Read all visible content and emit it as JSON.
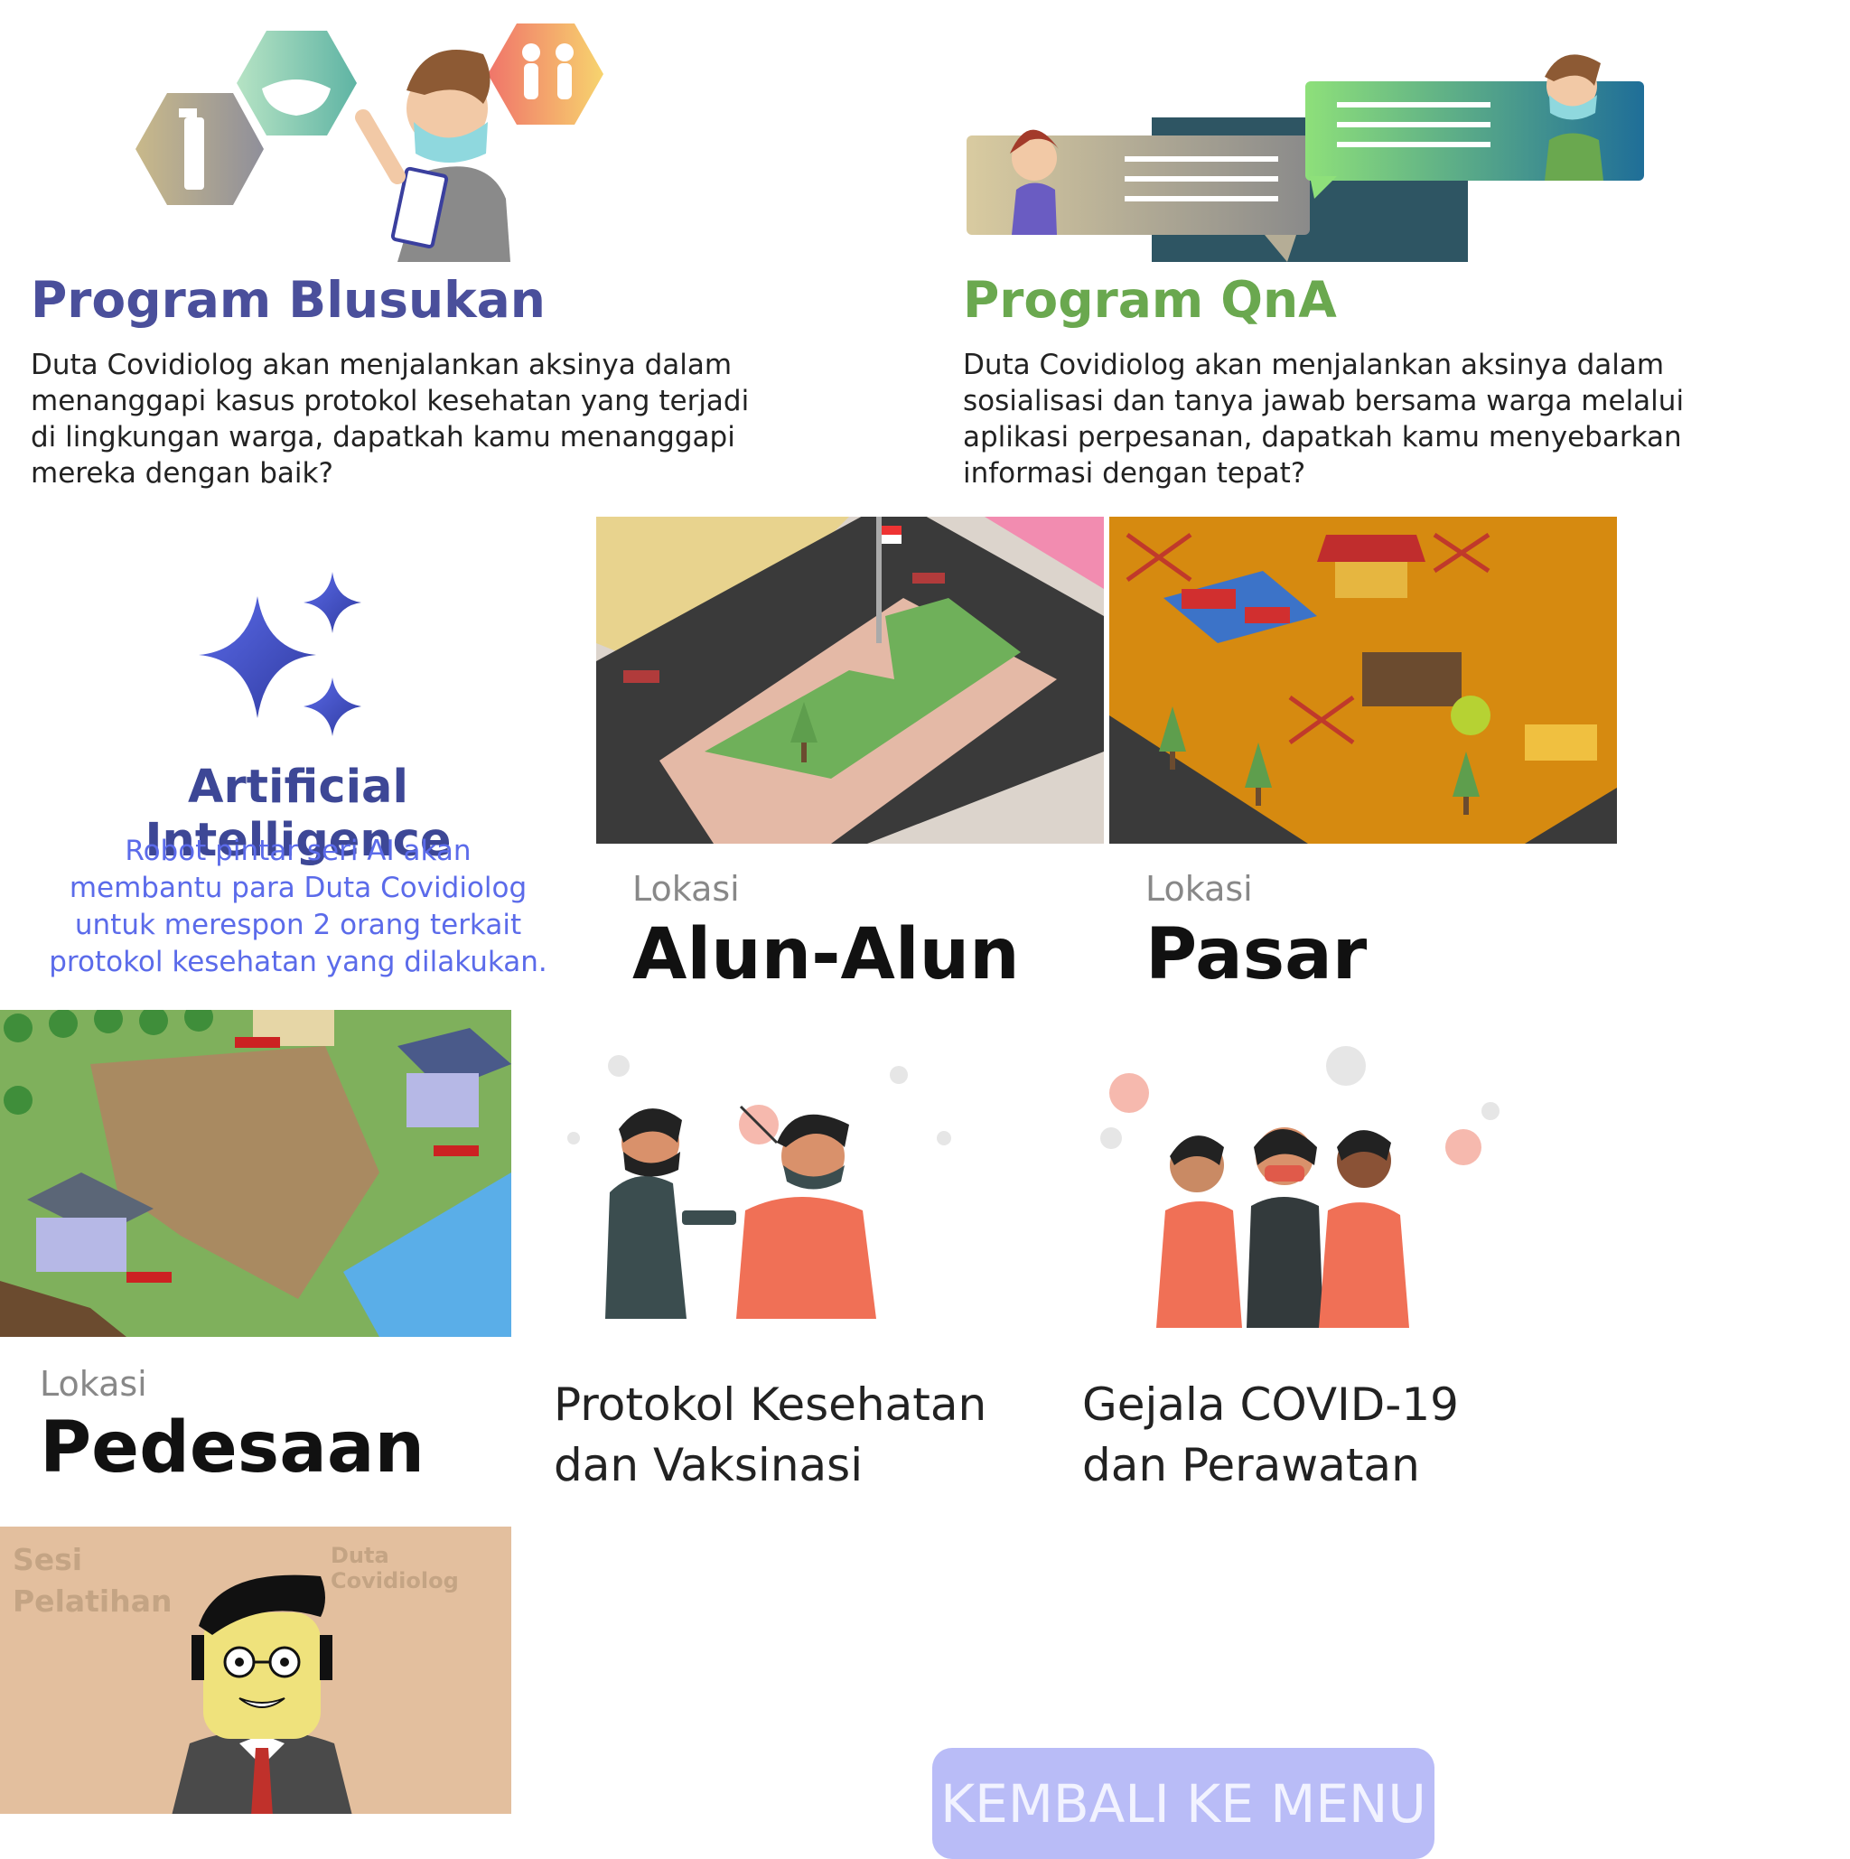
{
  "programs": {
    "blusukan": {
      "title": "Program Blusukan",
      "lines": [
        "Duta Covidiolog akan menjalankan aksinya dalam",
        "menanggapi kasus protokol kesehatan yang terjadi",
        "di lingkungan warga, dapatkah kamu menanggapi",
        "mereka dengan baik?"
      ]
    },
    "qna": {
      "title": "Program QnA",
      "lines": [
        "Duta Covidiolog akan menjalankan aksinya dalam",
        "sosialisasi dan tanya jawab bersama warga melalui",
        "aplikasi perpesanan, dapatkah kamu menyebarkan",
        "informasi dengan tepat?"
      ]
    }
  },
  "ai": {
    "title": "Artificial Intelligence",
    "lines": [
      "Robot pintar seri AI akan",
      "membantu para Duta Covidiolog",
      "untuk merespon 2 orang terkait",
      "protokol kesehatan yang dilakukan."
    ]
  },
  "locations": [
    {
      "label": "Lokasi",
      "name": "Alun-Alun"
    },
    {
      "label": "Lokasi",
      "name": "Pasar"
    },
    {
      "label": "Lokasi",
      "name": "Pedesaan"
    }
  ],
  "topics": [
    {
      "lines": [
        "Protokol Kesehatan",
        "dan Vaksinasi"
      ]
    },
    {
      "lines": [
        "Gejala COVID-19",
        "dan Perawatan"
      ]
    }
  ],
  "training": {
    "title_line1": "Sesi",
    "title_line2": "Pelatihan",
    "brand": "Duta Covidiolog"
  },
  "menu_button": "KEMBALI KE MENU",
  "icons": [
    "hand-sanitizer-icon",
    "face-mask-icon",
    "people-icon",
    "sparkle-icon"
  ],
  "colors": {
    "blusukan": "#4a4f9b",
    "qna": "#6aa84f",
    "ai_title": "#3d4796",
    "ai_desc": "#5b6bea",
    "button": "#b9bcf7"
  }
}
